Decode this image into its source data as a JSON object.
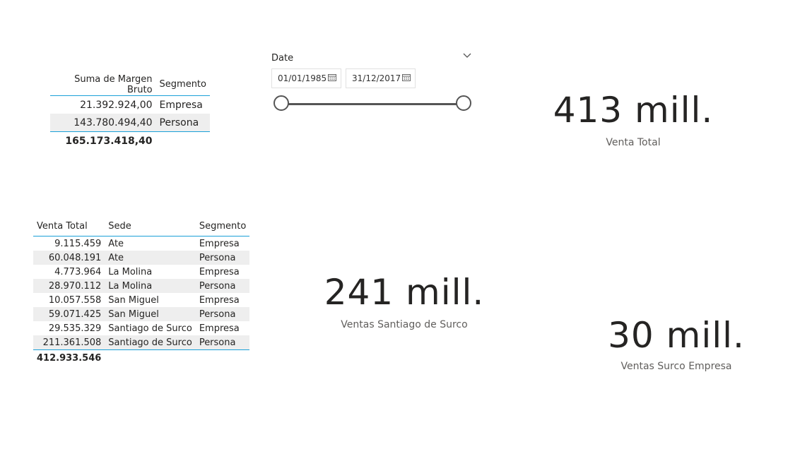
{
  "margen_table": {
    "headers": [
      "Suma de Margen Bruto",
      "Segmento"
    ],
    "rows": [
      {
        "value": "21.392.924,00",
        "segment": "Empresa"
      },
      {
        "value": "143.780.494,40",
        "segment": "Persona"
      }
    ],
    "total": "165.173.418,40"
  },
  "slicer": {
    "title": "Date",
    "start_date": "01/01/1985",
    "end_date": "31/12/2017",
    "icons": {
      "dropdown": "chevron-down-icon",
      "calendar": "calendar-icon"
    }
  },
  "cards": {
    "venta_total": {
      "value": "413 mill.",
      "label": "Venta Total"
    },
    "ventas_surco": {
      "value": "241 mill.",
      "label": "Ventas Santiago de Surco"
    },
    "ventas_surco_empresa": {
      "value": "30 mill.",
      "label": "Ventas Surco Empresa"
    }
  },
  "ventas_table": {
    "headers": [
      "Venta Total",
      "Sede",
      "Segmento"
    ],
    "rows": [
      {
        "venta": "9.115.459",
        "sede": "Ate",
        "segmento": "Empresa"
      },
      {
        "venta": "60.048.191",
        "sede": "Ate",
        "segmento": "Persona"
      },
      {
        "venta": "4.773.964",
        "sede": "La Molina",
        "segmento": "Empresa"
      },
      {
        "venta": "28.970.112",
        "sede": "La Molina",
        "segmento": "Persona"
      },
      {
        "venta": "10.057.558",
        "sede": "San Miguel",
        "segmento": "Empresa"
      },
      {
        "venta": "59.071.425",
        "sede": "San Miguel",
        "segmento": "Persona"
      },
      {
        "venta": "29.535.329",
        "sede": "Santiago de Surco",
        "segmento": "Empresa"
      },
      {
        "venta": "211.361.508",
        "sede": "Santiago de Surco",
        "segmento": "Persona"
      }
    ],
    "total": "412.933.546"
  },
  "colors": {
    "accent_line": "#1aa0d8",
    "row_alt": "#eeeeee",
    "text": "#252423",
    "label": "#605e5c"
  }
}
